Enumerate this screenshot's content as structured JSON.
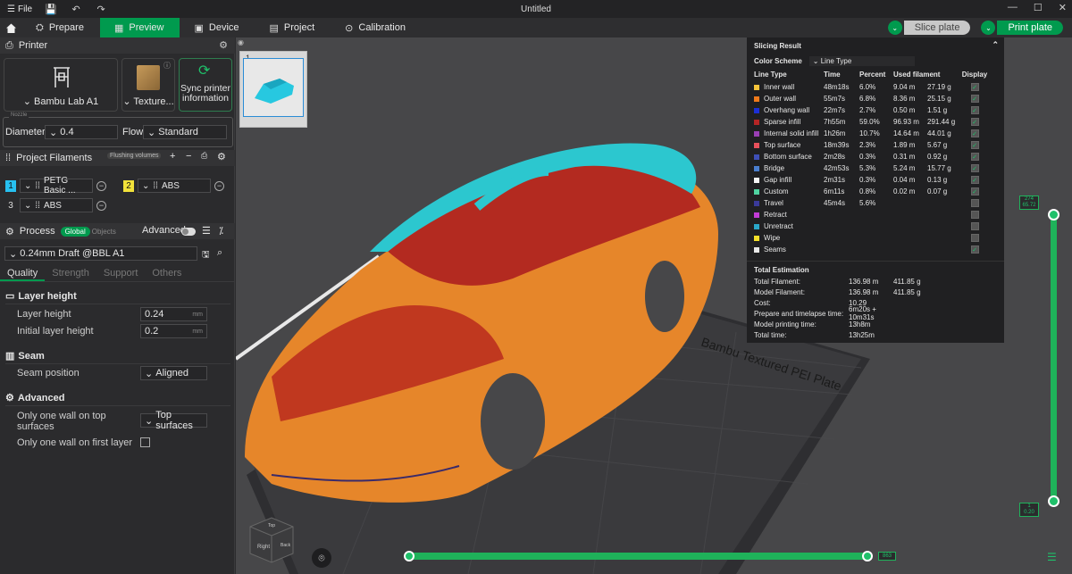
{
  "titlebar": {
    "file_label": "File",
    "title": "Untitled"
  },
  "nav": {
    "tabs": [
      {
        "label": "Prepare"
      },
      {
        "label": "Preview"
      },
      {
        "label": "Device"
      },
      {
        "label": "Project"
      },
      {
        "label": "Calibration"
      }
    ],
    "slice_label": "Slice plate",
    "print_label": "Print plate"
  },
  "printer": {
    "section_title": "Printer",
    "name": "Bambu Lab A1",
    "plate": "Texture...",
    "sync_line1": "Sync printer",
    "sync_line2": "information",
    "nozzle_legend": "Nozzle",
    "diameter_label": "Diameter",
    "diameter_value": "0.4",
    "flow_label": "Flow",
    "flow_value": "Standard"
  },
  "filaments": {
    "section_title": "Project Filaments",
    "flushing_label": "Flushing volumes",
    "items": [
      {
        "num": "1",
        "name": "PETG Basic ...",
        "color": "#27c0f0"
      },
      {
        "num": "2",
        "name": "ABS",
        "color": "#f2e23a"
      },
      {
        "num": "3",
        "name": "ABS",
        "color": "#2b2b2d"
      }
    ]
  },
  "process": {
    "section_title": "Process",
    "global_label": "Global",
    "objects_label": "Objects",
    "advanced_label": "Advanced",
    "preset": "0.24mm Draft @BBL A1",
    "subtabs": [
      "Quality",
      "Strength",
      "Support",
      "Others"
    ],
    "groups": {
      "layer_height": "Layer height",
      "seam": "Seam",
      "advanced": "Advanced"
    },
    "fields": {
      "layer_height_label": "Layer height",
      "layer_height_value": "0.24",
      "initial_layer_label": "Initial layer height",
      "initial_layer_value": "0.2",
      "unit": "mm",
      "seam_position_label": "Seam position",
      "seam_position_value": "Aligned",
      "one_wall_top_label_1": "Only one wall on top",
      "one_wall_top_label_2": "surfaces",
      "one_wall_top_value": "Top surfaces",
      "one_wall_first_label": "Only one wall on first layer"
    }
  },
  "viewport": {
    "plate_number": "1",
    "bed_text": "Bambu Textured PEI Plate"
  },
  "slicing_result": {
    "title": "Slicing Result",
    "color_scheme_label": "Color Scheme",
    "color_scheme_value": "Line Type",
    "headers": [
      "Line Type",
      "Time",
      "Percent",
      "Used filament",
      "Display"
    ],
    "rows": [
      {
        "name": "Inner wall",
        "color": "#f5c33a",
        "time": "48m18s",
        "pct": "6.0%",
        "len": "9.04 m",
        "wt": "27.19 g",
        "checked": true
      },
      {
        "name": "Outer wall",
        "color": "#f07a1a",
        "time": "55m7s",
        "pct": "6.8%",
        "len": "8.36 m",
        "wt": "25.15 g",
        "checked": true
      },
      {
        "name": "Overhang wall",
        "color": "#1c2fd6",
        "time": "22m7s",
        "pct": "2.7%",
        "len": "0.50 m",
        "wt": "1.51 g",
        "checked": true
      },
      {
        "name": "Sparse infill",
        "color": "#b52525",
        "time": "7h55m",
        "pct": "59.0%",
        "len": "96.93 m",
        "wt": "291.44 g",
        "checked": true
      },
      {
        "name": "Internal solid infill",
        "color": "#9a3fb5",
        "time": "1h26m",
        "pct": "10.7%",
        "len": "14.64 m",
        "wt": "44.01 g",
        "checked": true
      },
      {
        "name": "Top surface",
        "color": "#e8505b",
        "time": "18m39s",
        "pct": "2.3%",
        "len": "1.89 m",
        "wt": "5.67 g",
        "checked": true
      },
      {
        "name": "Bottom surface",
        "color": "#3e4fb8",
        "time": "2m28s",
        "pct": "0.3%",
        "len": "0.31 m",
        "wt": "0.92 g",
        "checked": true
      },
      {
        "name": "Bridge",
        "color": "#4a7fcf",
        "time": "42m53s",
        "pct": "5.3%",
        "len": "5.24 m",
        "wt": "15.77 g",
        "checked": true
      },
      {
        "name": "Gap infill",
        "color": "#f5f5f5",
        "time": "2m31s",
        "pct": "0.3%",
        "len": "0.04 m",
        "wt": "0.13 g",
        "checked": true
      },
      {
        "name": "Custom",
        "color": "#4fd3a0",
        "time": "6m11s",
        "pct": "0.8%",
        "len": "0.02 m",
        "wt": "0.07 g",
        "checked": true
      },
      {
        "name": "Travel",
        "color": "#3a3a9a",
        "time": "45m4s",
        "pct": "5.6%",
        "len": "",
        "wt": "",
        "checked": false
      },
      {
        "name": "Retract",
        "color": "#c23bd6",
        "time": "",
        "pct": "",
        "len": "",
        "wt": "",
        "checked": false
      },
      {
        "name": "Unretract",
        "color": "#2aa7c9",
        "time": "",
        "pct": "",
        "len": "",
        "wt": "",
        "checked": false
      },
      {
        "name": "Wipe",
        "color": "#f5e02a",
        "time": "",
        "pct": "",
        "len": "",
        "wt": "",
        "checked": false
      },
      {
        "name": "Seams",
        "color": "#e8e8e8",
        "time": "",
        "pct": "",
        "len": "",
        "wt": "",
        "checked": true
      }
    ],
    "total_title": "Total Estimation",
    "totals": [
      {
        "k": "Total Filament:",
        "v1": "136.98 m",
        "v2": "411.85 g"
      },
      {
        "k": "Model Filament:",
        "v1": "136.98 m",
        "v2": "411.85 g"
      },
      {
        "k": "Cost:",
        "v1": "10.29",
        "v2": ""
      },
      {
        "k": "Prepare and timelapse time:",
        "v1": "6m20s + 10m31s",
        "v2": ""
      },
      {
        "k": "Model printing time:",
        "v1": "13h8m",
        "v2": ""
      },
      {
        "k": "Total time:",
        "v1": "13h25m",
        "v2": ""
      }
    ]
  },
  "sliders": {
    "top_layer_num": "274",
    "top_layer_height": "65.72",
    "bottom_layer_num": "1",
    "bottom_layer_height": "0.20",
    "move_label": "863"
  },
  "nav_cube": {
    "top": "Top",
    "right": "Right",
    "back": "Back"
  }
}
